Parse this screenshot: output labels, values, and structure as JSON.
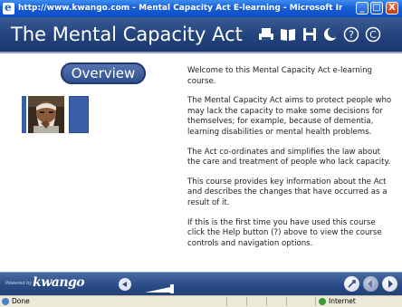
{
  "window": {
    "title": "http://www.kwango.com - Mental Capacity Act E-learning - Microsoft Internet Explorer provided by ...",
    "controls": {
      "minimize": "_",
      "maximize": "□",
      "close": "X"
    }
  },
  "header": {
    "title": "The Mental Capacity Act",
    "icons": [
      "print-icon",
      "book-icon",
      "save-icon",
      "moon-icon",
      "help-icon",
      "copyright-icon"
    ],
    "help_symbol": "?",
    "copyright_symbol": "C"
  },
  "main": {
    "section_label": "Overview",
    "paragraphs": [
      "Welcome to this Mental Capacity Act e-learning course.",
      "The Mental Capacity Act aims to protect people who may lack the capacity to make some decisions for themselves; for example, because of dementia, learning disabilities or mental health problems.",
      "The Act co-ordinates and simplifies the law about the care and treatment of people who lack capacity.",
      "This course provides key information about the Act and describes the changes that have occurred as a result of it.",
      "If this is the first time you have used this course click the Help button (?) above to view the course controls and navigation options."
    ]
  },
  "player": {
    "powered_by": "Powered by",
    "brand": "kwango",
    "icons": [
      "volume-icon",
      "volume-slider",
      "replay-icon",
      "back-icon",
      "forward-icon"
    ],
    "colors": {
      "bar": "#2b4b86",
      "accent_pill": "#3d5c9c"
    }
  },
  "statusbar": {
    "status": "Done",
    "zone": "Internet"
  }
}
